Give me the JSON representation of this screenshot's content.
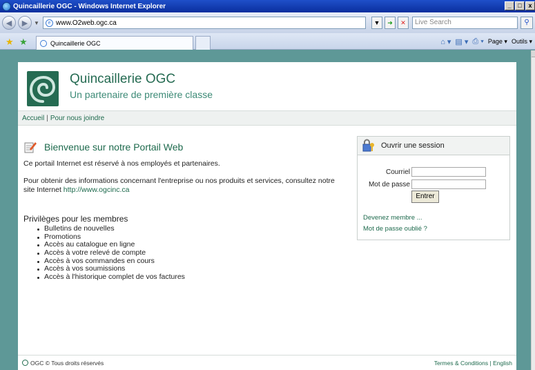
{
  "window": {
    "title": "Quincaillerie OGC - Windows Internet Explorer",
    "controls": [
      "_",
      "□",
      "x"
    ]
  },
  "addressbar": {
    "url": "www.O2web.ogc.ca",
    "search_placeholder": "Live Search"
  },
  "tabs": [
    {
      "label": "Quincaillerie OGC"
    }
  ],
  "toolbar": {
    "page_label": "Page",
    "tools_label": "Outils"
  },
  "site": {
    "title": "Quincaillerie OGC",
    "subtitle": "Un partenaire de première classe",
    "nav": [
      "Accueil",
      "Pour nous joindre"
    ],
    "nav_separator": "|"
  },
  "welcome": {
    "title": "Bienvenue sur notre Portail Web",
    "intro": "Ce portail Internet est réservé à nos employés et partenaires.",
    "info_text": "Pour obtenir des informations concernant l'entreprise ou nos produits et services, consultez notre site Internet",
    "info_link": "http://www.ogcinc.ca"
  },
  "privileges": {
    "title": "Privilèges pour les membres",
    "items": [
      "Bulletins de nouvelles",
      "Promotions",
      "Accès au catalogue en ligne",
      "Accès à votre relevé de compte",
      "Accès à vos commandes en cours",
      "Accès à vos soumissions",
      "Accès à l'historique complet de vos factures"
    ]
  },
  "login": {
    "title": "Ouvrir une session",
    "email_label": "Courriel",
    "email_value": "",
    "password_label": "Mot de passe",
    "password_value": "",
    "submit_label": "Entrer",
    "become_member": "Devenez membre ...",
    "forgot_password": "Mot de passe oublié ?"
  },
  "footer": {
    "copyright": "OGC © Tous droits réservés",
    "terms": "Termes & Conditions",
    "separator": "|",
    "english": "English"
  },
  "colors": {
    "background": "#5e9897",
    "brand_green": "#256b52",
    "link_green": "#1e6a4d",
    "ie_title": "#1f4fc9"
  }
}
